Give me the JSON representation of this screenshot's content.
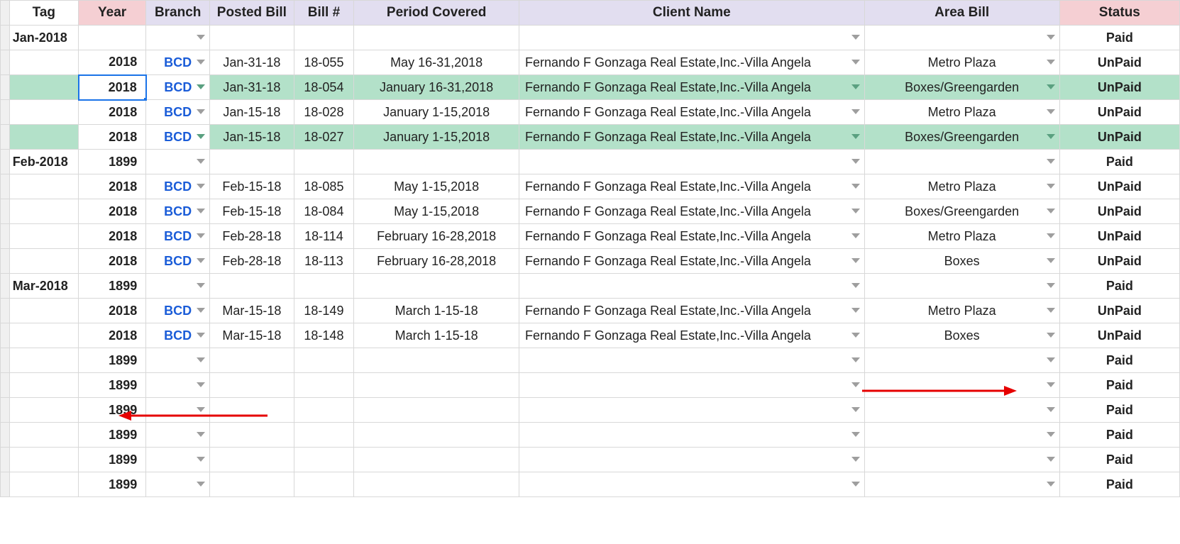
{
  "headers": {
    "tag": "Tag",
    "year": "Year",
    "branch": "Branch",
    "posted": "Posted Bill",
    "billn": "Bill #",
    "period": "Period Covered",
    "client": "Client Name",
    "area": "Area Bill",
    "status": "Status"
  },
  "rows": [
    {
      "tag": "Jan-2018",
      "year": "",
      "branch": "",
      "posted": "",
      "billn": "",
      "period": "",
      "client": "",
      "area": "",
      "status": "Paid",
      "hl": false,
      "sel": false
    },
    {
      "tag": "",
      "year": "2018",
      "branch": "BCD",
      "posted": "Jan-31-18",
      "billn": "18-055",
      "period": "May 16-31,2018",
      "client": "Fernando F Gonzaga Real Estate,Inc.-Villa Angela",
      "area": "Metro Plaza",
      "status": "UnPaid",
      "hl": false,
      "sel": false
    },
    {
      "tag": "",
      "year": "2018",
      "branch": "BCD",
      "posted": "Jan-31-18",
      "billn": "18-054",
      "period": "January 16-31,2018",
      "client": "Fernando F Gonzaga Real Estate,Inc.-Villa Angela",
      "area": "Boxes/Greengarden",
      "status": "UnPaid",
      "hl": true,
      "sel": true
    },
    {
      "tag": "",
      "year": "2018",
      "branch": "BCD",
      "posted": "Jan-15-18",
      "billn": "18-028",
      "period": "January 1-15,2018",
      "client": "Fernando F Gonzaga Real Estate,Inc.-Villa Angela",
      "area": "Metro Plaza",
      "status": "UnPaid",
      "hl": false,
      "sel": false
    },
    {
      "tag": "",
      "year": "2018",
      "branch": "BCD",
      "posted": "Jan-15-18",
      "billn": "18-027",
      "period": "January 1-15,2018",
      "client": "Fernando F Gonzaga Real Estate,Inc.-Villa Angela",
      "area": "Boxes/Greengarden",
      "status": "UnPaid",
      "hl": true,
      "sel": false
    },
    {
      "tag": "Feb-2018",
      "year": "1899",
      "branch": "",
      "posted": "",
      "billn": "",
      "period": "",
      "client": "",
      "area": "",
      "status": "Paid",
      "hl": false,
      "sel": false
    },
    {
      "tag": "",
      "year": "2018",
      "branch": "BCD",
      "posted": "Feb-15-18",
      "billn": "18-085",
      "period": "May 1-15,2018",
      "client": "Fernando F Gonzaga Real Estate,Inc.-Villa Angela",
      "area": "Metro Plaza",
      "status": "UnPaid",
      "hl": false,
      "sel": false
    },
    {
      "tag": "",
      "year": "2018",
      "branch": "BCD",
      "posted": "Feb-15-18",
      "billn": "18-084",
      "period": "May 1-15,2018",
      "client": "Fernando F Gonzaga Real Estate,Inc.-Villa Angela",
      "area": "Boxes/Greengarden",
      "status": "UnPaid",
      "hl": false,
      "sel": false
    },
    {
      "tag": "",
      "year": "2018",
      "branch": "BCD",
      "posted": "Feb-28-18",
      "billn": "18-114",
      "period": "February 16-28,2018",
      "client": "Fernando F Gonzaga Real Estate,Inc.-Villa Angela",
      "area": "Metro Plaza",
      "status": "UnPaid",
      "hl": false,
      "sel": false
    },
    {
      "tag": "",
      "year": "2018",
      "branch": "BCD",
      "posted": "Feb-28-18",
      "billn": "18-113",
      "period": "February 16-28,2018",
      "client": "Fernando F Gonzaga Real Estate,Inc.-Villa Angela",
      "area": "Boxes",
      "status": "UnPaid",
      "hl": false,
      "sel": false
    },
    {
      "tag": "Mar-2018",
      "year": "1899",
      "branch": "",
      "posted": "",
      "billn": "",
      "period": "",
      "client": "",
      "area": "",
      "status": "Paid",
      "hl": false,
      "sel": false
    },
    {
      "tag": "",
      "year": "2018",
      "branch": "BCD",
      "posted": "Mar-15-18",
      "billn": "18-149",
      "period": "March 1-15-18",
      "client": "Fernando F Gonzaga Real Estate,Inc.-Villa Angela",
      "area": "Metro Plaza",
      "status": "UnPaid",
      "hl": false,
      "sel": false
    },
    {
      "tag": "",
      "year": "2018",
      "branch": "BCD",
      "posted": "Mar-15-18",
      "billn": "18-148",
      "period": "March 1-15-18",
      "client": "Fernando F Gonzaga Real Estate,Inc.-Villa Angela",
      "area": "Boxes",
      "status": "UnPaid",
      "hl": false,
      "sel": false
    },
    {
      "tag": "",
      "year": "1899",
      "branch": "",
      "posted": "",
      "billn": "",
      "period": "",
      "client": "",
      "area": "",
      "status": "Paid",
      "hl": false,
      "sel": false
    },
    {
      "tag": "",
      "year": "1899",
      "branch": "",
      "posted": "",
      "billn": "",
      "period": "",
      "client": "",
      "area": "",
      "status": "Paid",
      "hl": false,
      "sel": false
    },
    {
      "tag": "",
      "year": "1899",
      "branch": "",
      "posted": "",
      "billn": "",
      "period": "",
      "client": "",
      "area": "",
      "status": "Paid",
      "hl": false,
      "sel": false
    },
    {
      "tag": "",
      "year": "1899",
      "branch": "",
      "posted": "",
      "billn": "",
      "period": "",
      "client": "",
      "area": "",
      "status": "Paid",
      "hl": false,
      "sel": false
    },
    {
      "tag": "",
      "year": "1899",
      "branch": "",
      "posted": "",
      "billn": "",
      "period": "",
      "client": "",
      "area": "",
      "status": "Paid",
      "hl": false,
      "sel": false
    },
    {
      "tag": "",
      "year": "1899",
      "branch": "",
      "posted": "",
      "billn": "",
      "period": "",
      "client": "",
      "area": "",
      "status": "Paid",
      "hl": false,
      "sel": false
    }
  ]
}
